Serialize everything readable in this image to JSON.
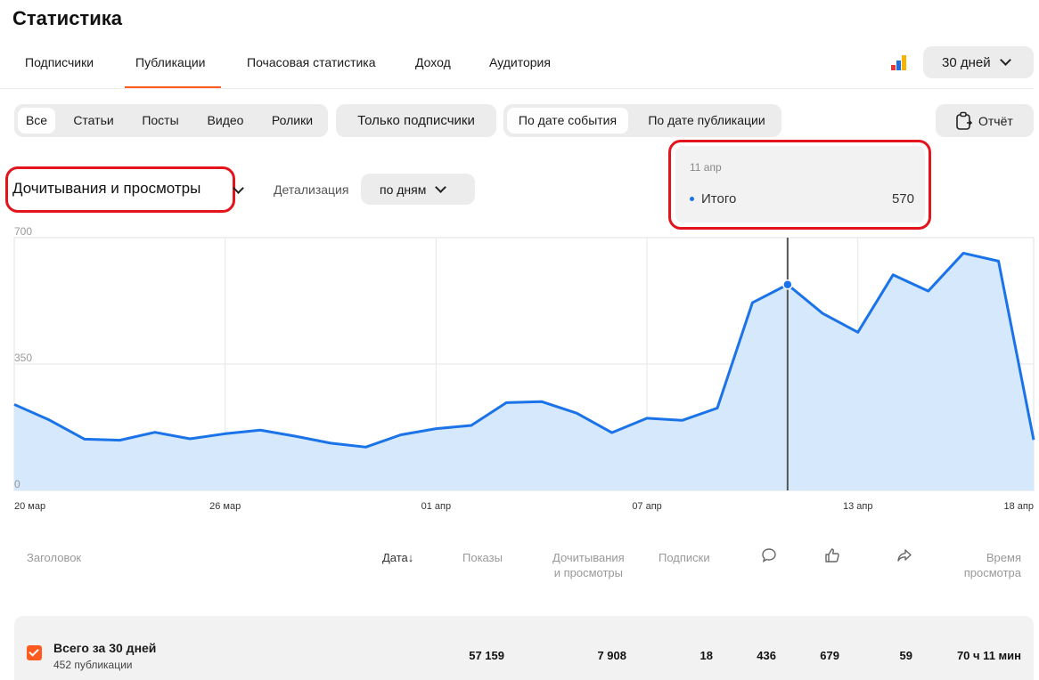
{
  "page": {
    "title": "Статистика"
  },
  "tabs": [
    {
      "label": "Подписчики"
    },
    {
      "label": "Публикации",
      "active": true
    },
    {
      "label": "Почасовая статистика"
    },
    {
      "label": "Доход"
    },
    {
      "label": "Аудитория"
    }
  ],
  "period": {
    "label": "30 дней"
  },
  "type_filter": [
    "Все",
    "Статьи",
    "Посты",
    "Видео",
    "Ролики"
  ],
  "type_filter_selected": "Все",
  "subscribers_only_label": "Только подписчики",
  "date_mode": [
    "По дате события",
    "По дате публикации"
  ],
  "date_mode_selected": "По дате события",
  "report_button": "Отчёт",
  "metric": {
    "label": "Дочитывания и просмотры"
  },
  "detail": {
    "label": "Детализация",
    "value": "по дням"
  },
  "tooltip": {
    "date": "11 апр",
    "series": "Итого",
    "value": "570"
  },
  "colors": {
    "accent": "#ff5a1f",
    "line": "#1a73e8",
    "area": "#d6e8fb",
    "highlight_box": "#e3141c"
  },
  "chart_data": {
    "type": "area",
    "x": [
      "20 мар",
      "21 мар",
      "22 мар",
      "23 мар",
      "24 мар",
      "25 мар",
      "26 мар",
      "27 мар",
      "28 мар",
      "29 мар",
      "30 мар",
      "31 мар",
      "01 апр",
      "02 апр",
      "03 апр",
      "04 апр",
      "05 апр",
      "06 апр",
      "07 апр",
      "08 апр",
      "09 апр",
      "10 апр",
      "11 апр",
      "12 апр",
      "13 апр",
      "14 апр",
      "15 апр",
      "16 апр",
      "17 апр",
      "18 апр"
    ],
    "series": [
      {
        "name": "Итого",
        "values": [
          238,
          195,
          142,
          139,
          161,
          143,
          157,
          167,
          150,
          131,
          120,
          154,
          171,
          180,
          243,
          246,
          214,
          160,
          200,
          194,
          228,
          520,
          570,
          490,
          438,
          597,
          552,
          657,
          635,
          140
        ]
      }
    ],
    "x_tick_labels": [
      "20 мар",
      "26 мар",
      "01 апр",
      "07 апр",
      "13 апр",
      "18 апр"
    ],
    "y_tick_labels": [
      "700",
      "350",
      "0"
    ],
    "ylim": [
      0,
      700
    ],
    "highlight": {
      "x": "11 апр",
      "value": 570
    },
    "grid": true
  },
  "table": {
    "headers": {
      "title": "Заголовок",
      "date": "Дата",
      "sort_arrow": "↓",
      "impressions": "Показы",
      "reads_1": "Дочитывания",
      "reads_2": "и просмотры",
      "subscriptions": "Подписки",
      "time_1": "Время",
      "time_2": "просмотра"
    },
    "header_icons": [
      "comment-icon",
      "like-icon",
      "share-icon"
    ],
    "total": {
      "title": "Всего за 30 дней",
      "subtitle": "452 публикации",
      "impressions": "57 159",
      "reads": "7 908",
      "subscriptions": "18",
      "comments": "436",
      "likes": "679",
      "shares": "59",
      "time": "70 ч 11 мин"
    }
  }
}
